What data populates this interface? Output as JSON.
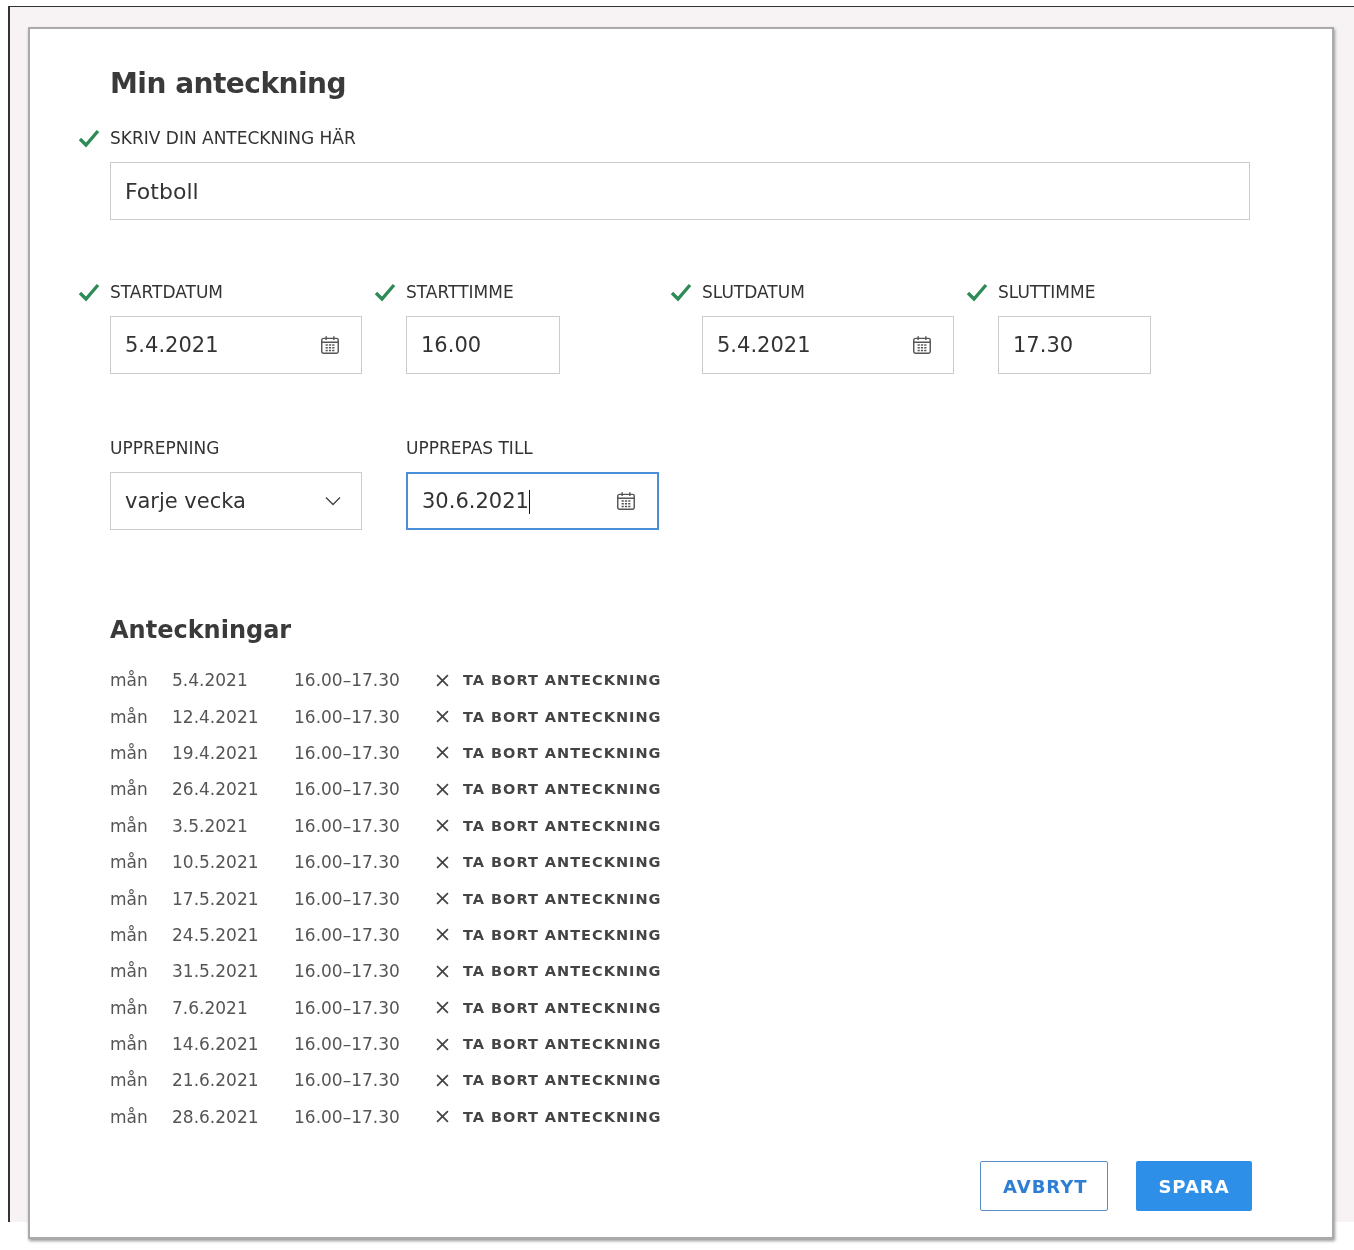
{
  "dialog": {
    "title": "Min anteckning"
  },
  "note_field": {
    "label": "SKRIV DIN ANTECKNING HÄR",
    "value": "Fotboll",
    "valid": true
  },
  "fields": [
    {
      "label": "STARTDATUM",
      "value": "5.4.2021",
      "kind": "date",
      "valid": true,
      "focused": false
    },
    {
      "label": "STARTTIMME",
      "value": "16.00",
      "kind": "text",
      "valid": true,
      "focused": false
    },
    {
      "label": "SLUTDATUM",
      "value": "5.4.2021",
      "kind": "date",
      "valid": true,
      "focused": false
    },
    {
      "label": "SLUTTIMME",
      "value": "17.30",
      "kind": "text",
      "valid": true,
      "focused": false
    },
    {
      "label": "UPPREPNING",
      "value": "varje vecka",
      "kind": "select",
      "valid": false,
      "focused": false
    },
    {
      "label": "UPPREPAS TILL",
      "value": "30.6.2021",
      "kind": "date",
      "valid": false,
      "focused": true
    }
  ],
  "notes": {
    "title": "Anteckningar",
    "rows": [
      {
        "day": "mån",
        "date": "5.4.2021",
        "time": "16.00–17.30",
        "action": "TA BORT ANTECKNING"
      },
      {
        "day": "mån",
        "date": "12.4.2021",
        "time": "16.00–17.30",
        "action": "TA BORT ANTECKNING"
      },
      {
        "day": "mån",
        "date": "19.4.2021",
        "time": "16.00–17.30",
        "action": "TA BORT ANTECKNING"
      },
      {
        "day": "mån",
        "date": "26.4.2021",
        "time": "16.00–17.30",
        "action": "TA BORT ANTECKNING"
      },
      {
        "day": "mån",
        "date": "3.5.2021",
        "time": "16.00–17.30",
        "action": "TA BORT ANTECKNING"
      },
      {
        "day": "mån",
        "date": "10.5.2021",
        "time": "16.00–17.30",
        "action": "TA BORT ANTECKNING"
      },
      {
        "day": "mån",
        "date": "17.5.2021",
        "time": "16.00–17.30",
        "action": "TA BORT ANTECKNING"
      },
      {
        "day": "mån",
        "date": "24.5.2021",
        "time": "16.00–17.30",
        "action": "TA BORT ANTECKNING"
      },
      {
        "day": "mån",
        "date": "31.5.2021",
        "time": "16.00–17.30",
        "action": "TA BORT ANTECKNING"
      },
      {
        "day": "mån",
        "date": "7.6.2021",
        "time": "16.00–17.30",
        "action": "TA BORT ANTECKNING"
      },
      {
        "day": "mån",
        "date": "14.6.2021",
        "time": "16.00–17.30",
        "action": "TA BORT ANTECKNING"
      },
      {
        "day": "mån",
        "date": "21.6.2021",
        "time": "16.00–17.30",
        "action": "TA BORT ANTECKNING"
      },
      {
        "day": "mån",
        "date": "28.6.2021",
        "time": "16.00–17.30",
        "action": "TA BORT ANTECKNING"
      }
    ]
  },
  "buttons": [
    {
      "label": "AVBRYT",
      "kind": "secondary"
    },
    {
      "label": "SPARA",
      "kind": "primary"
    }
  ]
}
